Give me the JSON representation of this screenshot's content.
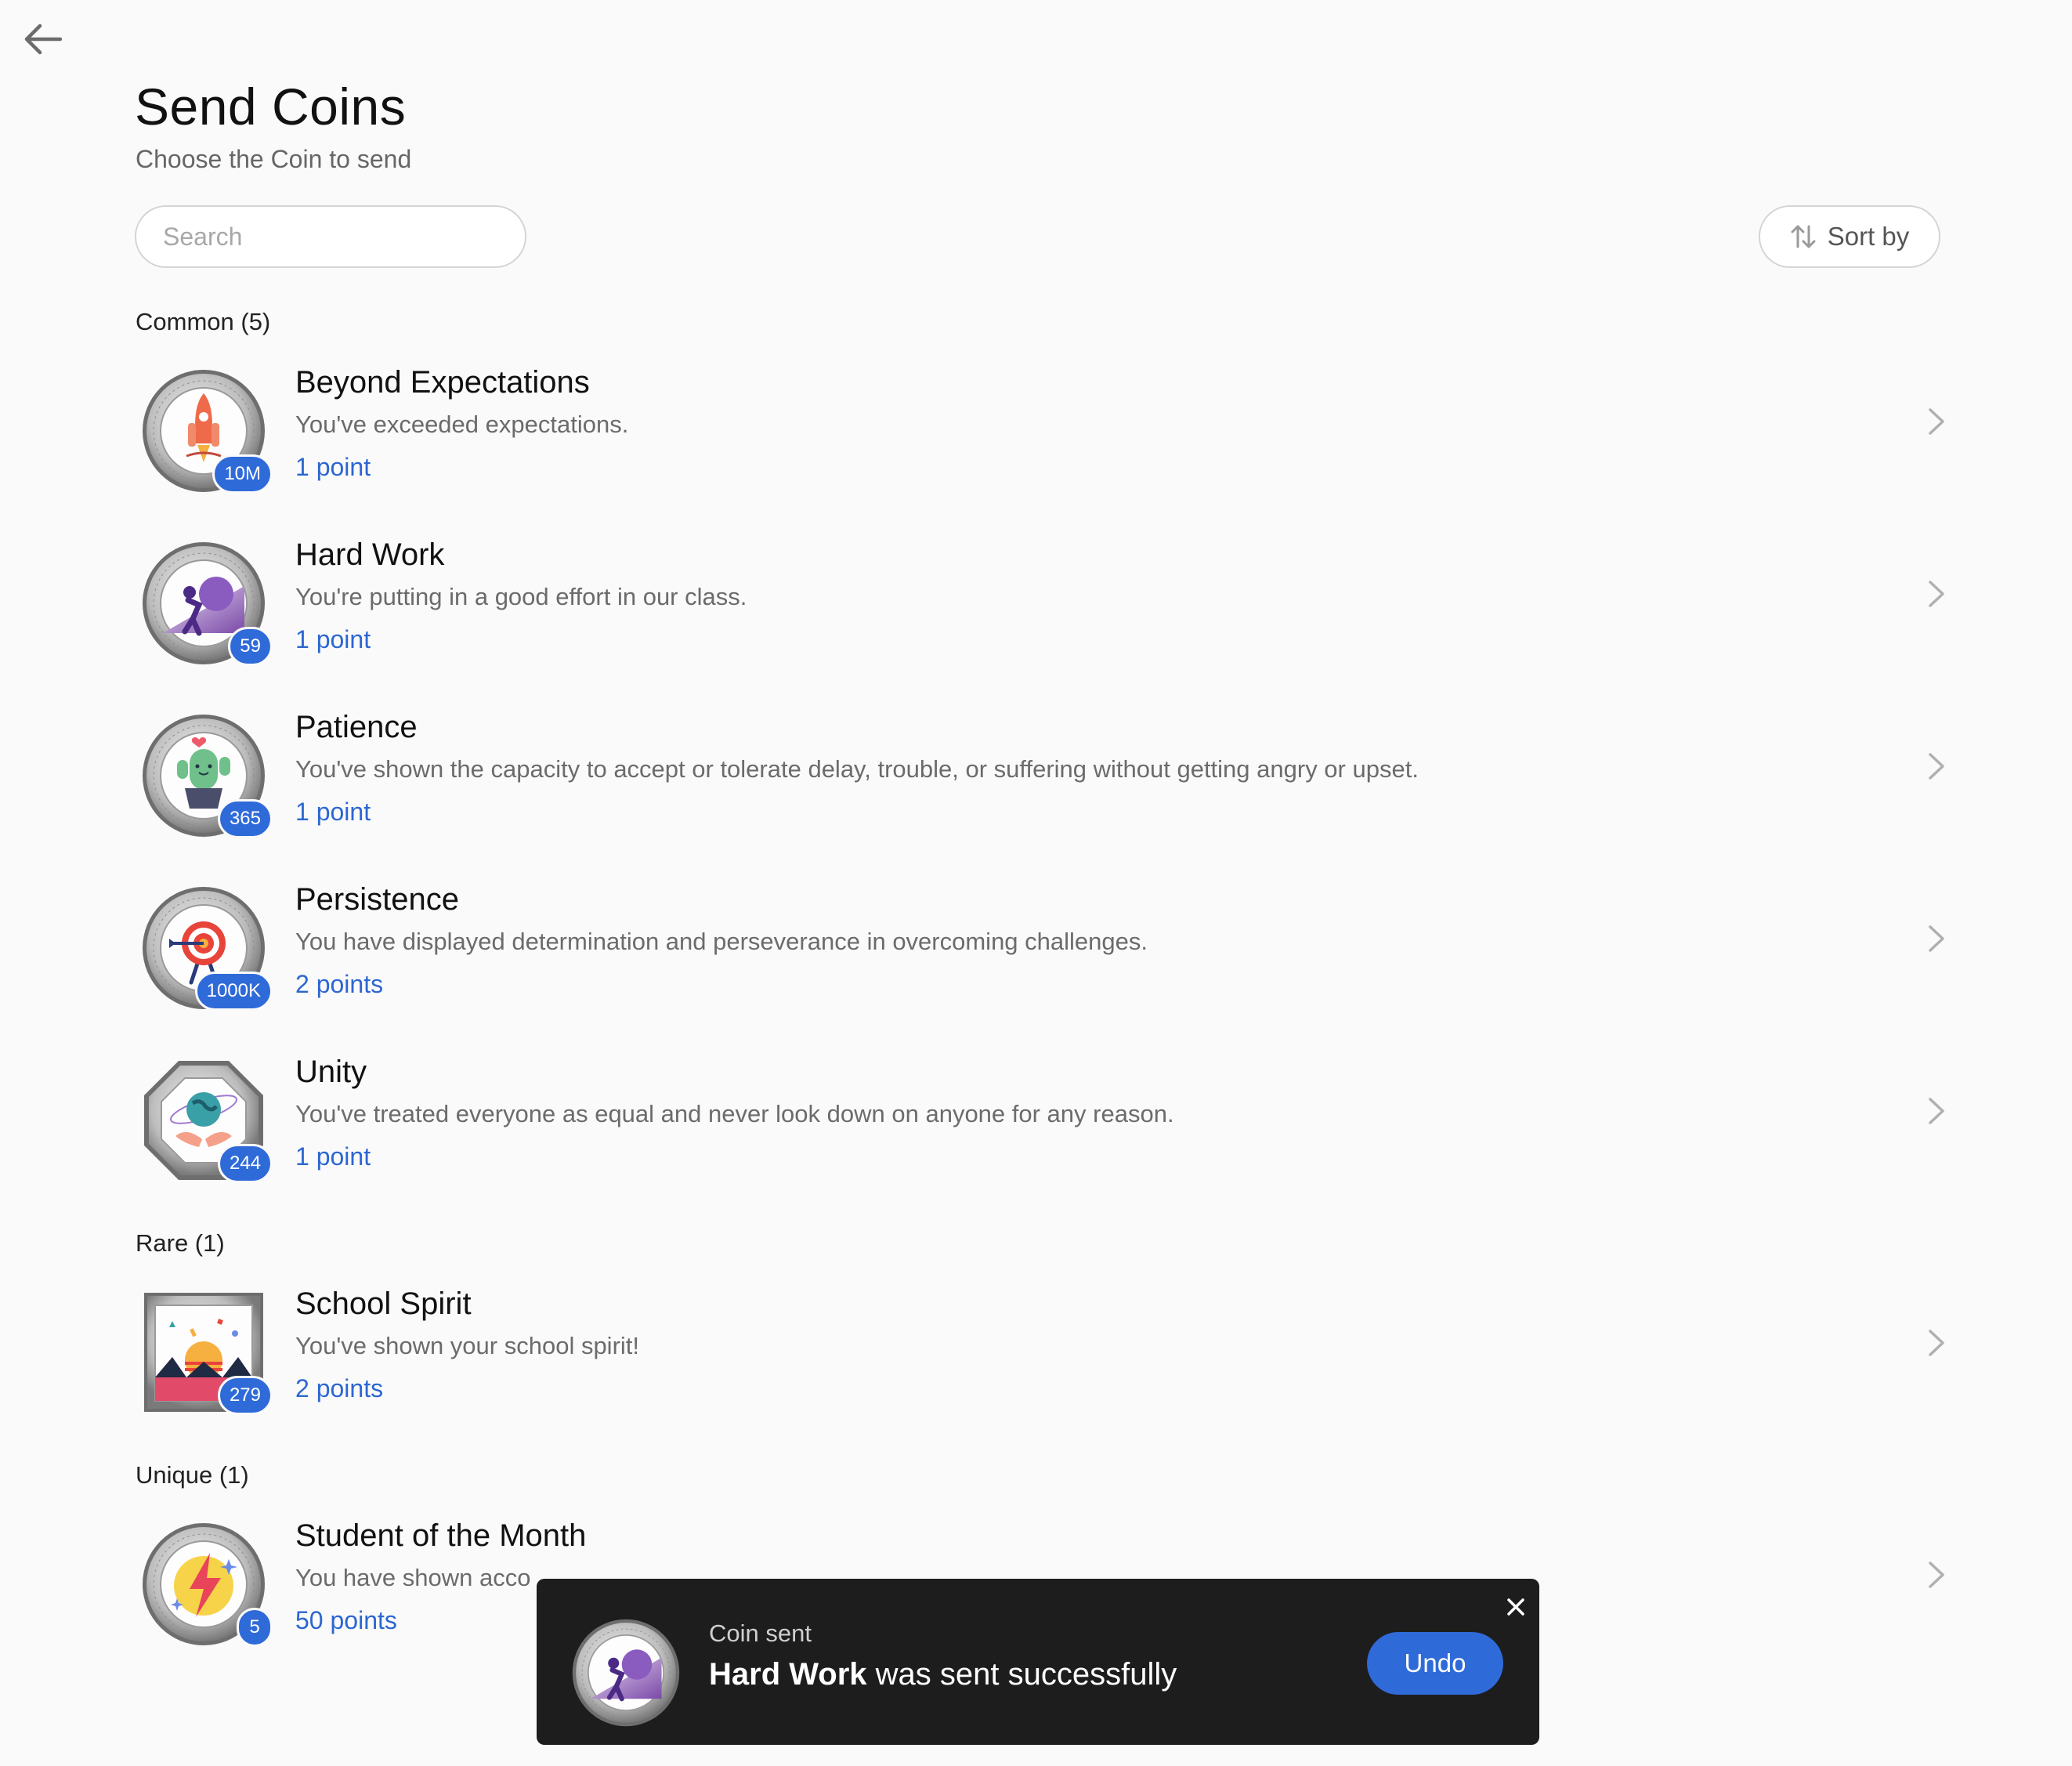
{
  "header": {
    "title": "Send Coins",
    "subtitle": "Choose the Coin to send"
  },
  "search": {
    "placeholder": "Search",
    "value": ""
  },
  "sort": {
    "label": "Sort by"
  },
  "sections": [
    {
      "heading": "Common (5)",
      "coins": [
        {
          "name": "Beyond Expectations",
          "description": "You've exceeded expectations.",
          "points": "1 point",
          "count": "10M",
          "icon": "rocket-icon"
        },
        {
          "name": "Hard Work",
          "description": "You're putting in a good effort in our class.",
          "points": "1 point",
          "count": "59",
          "icon": "boulder-push-icon"
        },
        {
          "name": "Patience",
          "description": "You've shown the capacity to accept or tolerate delay, trouble, or suffering without getting angry or upset.",
          "points": "1 point",
          "count": "365",
          "icon": "cactus-icon"
        },
        {
          "name": "Persistence",
          "description": "You have displayed determination and perseverance in overcoming challenges.",
          "points": "2 points",
          "count": "1000K",
          "icon": "target-icon"
        },
        {
          "name": "Unity",
          "description": "You've treated everyone as equal and never look down on anyone for any reason.",
          "points": "1 point",
          "count": "244",
          "icon": "globe-hands-icon"
        }
      ]
    },
    {
      "heading": "Rare (1)",
      "coins": [
        {
          "name": "School Spirit",
          "description": "You've shown your school spirit!",
          "points": "2 points",
          "count": "279",
          "icon": "sunset-confetti-icon"
        }
      ]
    },
    {
      "heading": "Unique (1)",
      "coins": [
        {
          "name": "Student of the Month",
          "description": "You have shown acco",
          "points": "50 points",
          "count": "5",
          "icon": "lightning-icon"
        }
      ]
    }
  ],
  "toast": {
    "label": "Coin sent",
    "coin_name": "Hard Work",
    "message_rest": " was sent successfully",
    "undo_label": "Undo"
  },
  "colors": {
    "accent": "#2f6ad9",
    "background": "#fafafa",
    "toast_background": "#1d1d1d"
  }
}
